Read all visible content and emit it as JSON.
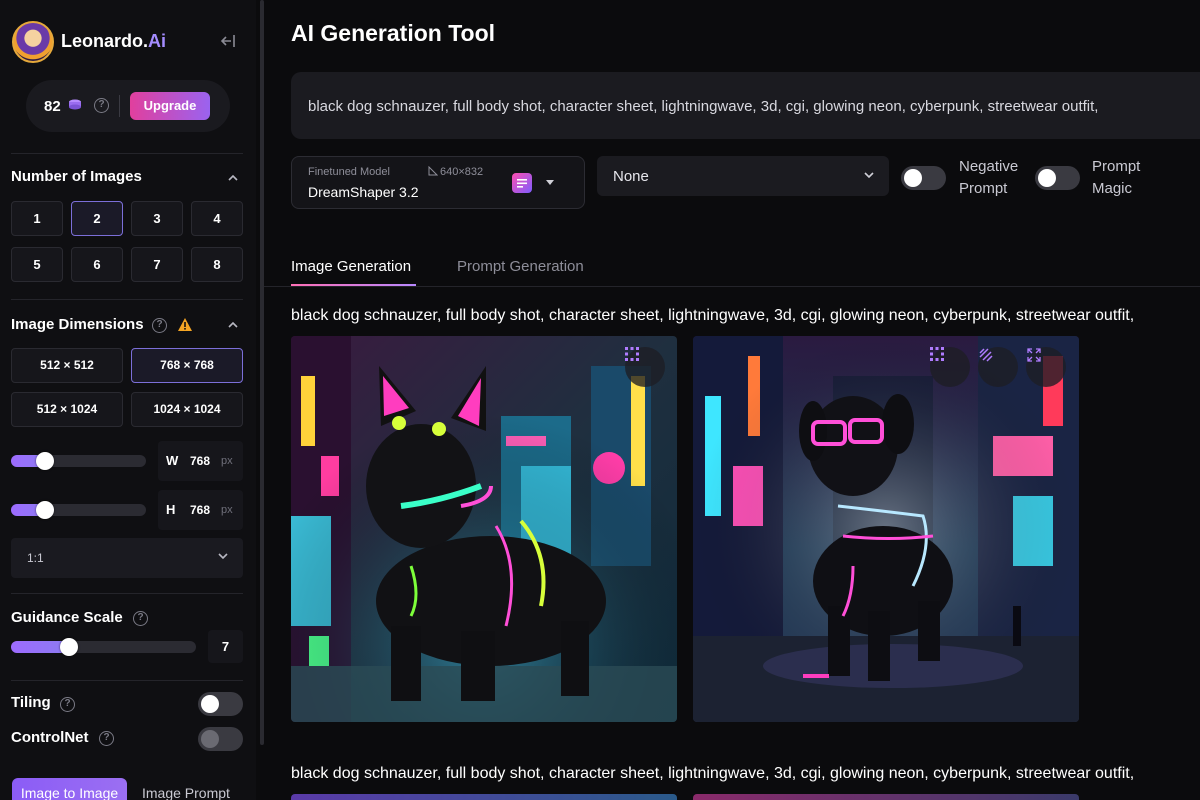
{
  "brand": {
    "name": "Leonardo.",
    "name_ai": "Ai"
  },
  "credits": {
    "count": "82",
    "upgrade_label": "Upgrade"
  },
  "num_images": {
    "title": "Number of Images",
    "options": [
      "1",
      "2",
      "3",
      "4",
      "5",
      "6",
      "7",
      "8"
    ],
    "selected": "2"
  },
  "dimensions": {
    "title": "Image Dimensions",
    "presets": [
      "512 × 512",
      "768 × 768",
      "512 × 1024",
      "1024 × 1024"
    ],
    "selected": "768 × 768",
    "width": {
      "letter": "W",
      "value": "768",
      "unit": "px"
    },
    "height": {
      "letter": "H",
      "value": "768",
      "unit": "px"
    },
    "ratio": "1:1"
  },
  "guidance": {
    "title": "Guidance Scale",
    "value": "7"
  },
  "tiling": {
    "label": "Tiling"
  },
  "controlnet": {
    "label": "ControlNet"
  },
  "bottom_tabs": {
    "image_to_image": "Image to Image",
    "image_prompt": "Image Prompt"
  },
  "main": {
    "title": "AI Generation Tool",
    "prompt": "black dog schnauzer, full body shot, character sheet, lightningwave, 3d, cgi, glowing neon, cyberpunk, streetwear outfit,",
    "model": {
      "caption": "Finetuned Model",
      "dims": "640×832",
      "name": "DreamShaper 3.2"
    },
    "style": "None",
    "negative_prompt_label": "Negative Prompt",
    "prompt_magic_label": "Prompt Magic",
    "tabs": [
      "Image Generation",
      "Prompt Generation"
    ],
    "generation_prompt": "black dog schnauzer, full body shot, character sheet, lightningwave, 3d, cgi, glowing neon, cyberpunk, streetwear outfit,"
  },
  "colors": {
    "accent": "#9d6bff",
    "upgrade_start": "#e13f9d",
    "upgrade_end": "#9a63f0",
    "bg": "#0b0b0d"
  }
}
